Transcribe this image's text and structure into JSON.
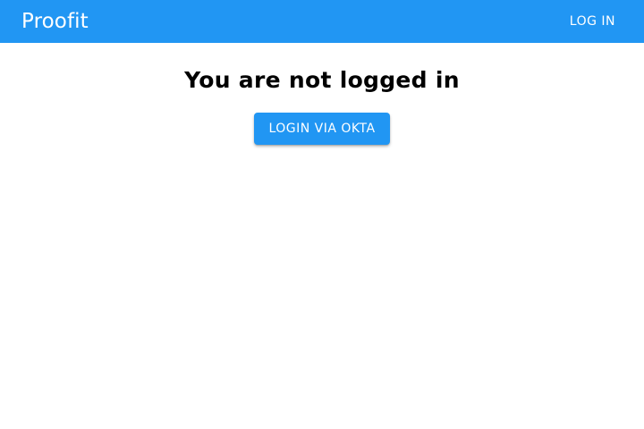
{
  "header": {
    "title": "Proofit",
    "login_label": "LOG IN"
  },
  "main": {
    "heading": "You are not logged in",
    "okta_button_label": "LOGIN VIA OKTA"
  },
  "colors": {
    "primary": "#2196f3",
    "on_primary": "#ffffff"
  }
}
